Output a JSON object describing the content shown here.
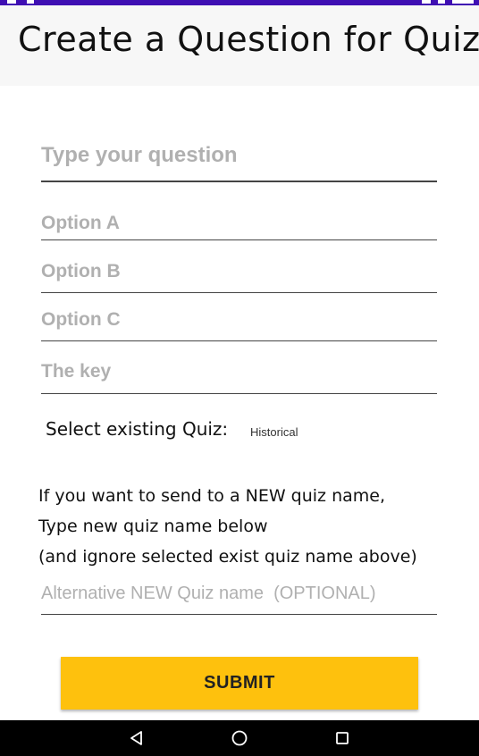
{
  "header": {
    "title": "Create a Question for Quiz"
  },
  "form": {
    "question_placeholder": "Type your question",
    "option_a_placeholder": "Option A",
    "option_b_placeholder": "Option B",
    "option_c_placeholder": "Option C",
    "key_placeholder": "The key",
    "select_label": "Select existing Quiz:",
    "selected_quiz": "Historical",
    "instructions": [
      "If you want to send to a NEW quiz name,",
      "Type new quiz name below",
      "(and ignore selected exist quiz name above)"
    ],
    "alt_quiz_placeholder": "Alternative NEW Quiz name  (OPTIONAL)",
    "submit_label": "SUBMIT"
  },
  "icons": {
    "nav_back": "back-triangle-icon",
    "nav_home": "home-circle-icon",
    "nav_recents": "recents-square-icon"
  },
  "colors": {
    "status_bar": "#3f0fb3",
    "submit_button": "#fec10d",
    "nav_bar": "#000000"
  }
}
